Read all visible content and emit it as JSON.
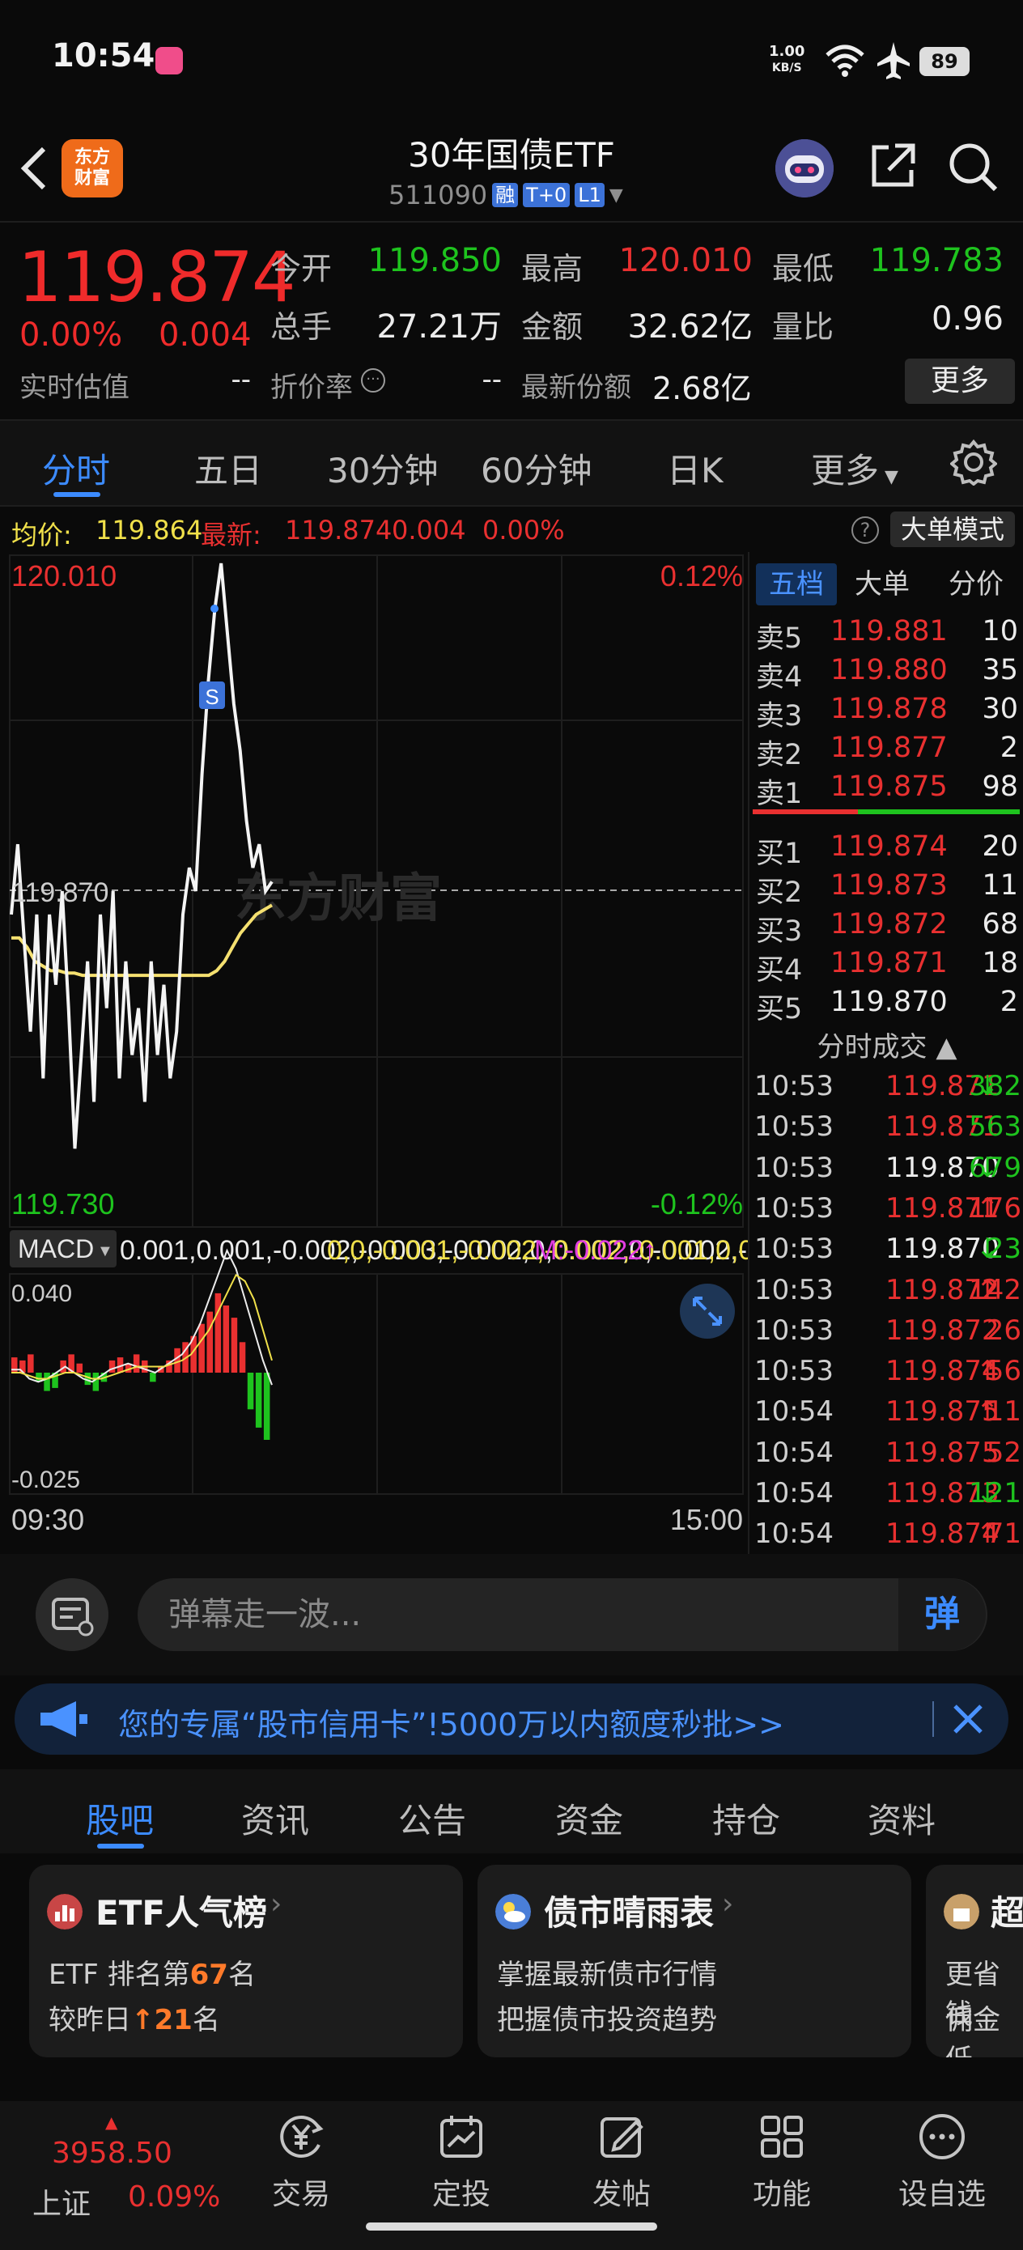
{
  "status_bar": {
    "time": "10:54",
    "speed_value": "1.00",
    "speed_unit": "KB/S",
    "battery": "89"
  },
  "header": {
    "title": "30年国债ETF",
    "code": "511090",
    "tags": [
      "融",
      "T+0",
      "L1"
    ],
    "logo_line1": "东方",
    "logo_line2": "财富"
  },
  "quote": {
    "price": "119.874",
    "change_pct": "0.00%",
    "change": "0.004",
    "open_label": "今开",
    "open": "119.850",
    "high_label": "最高",
    "high": "120.010",
    "low_label": "最低",
    "low": "119.783",
    "volume_label": "总手",
    "volume": "27.21万",
    "amount_label": "金额",
    "amount": "32.62亿",
    "ratio_label": "量比",
    "ratio": "0.96",
    "est_label": "实时估值",
    "est": "--",
    "discount_label": "折价率",
    "discount": "--",
    "shares_label": "最新份额",
    "shares": "2.68亿",
    "more_label": "更多"
  },
  "tabs": [
    "分时",
    "五日",
    "30分钟",
    "60分钟",
    "日K",
    "更多"
  ],
  "avg_row": {
    "avg_label": "均价:",
    "avg": "119.864",
    "latest_label": "最新:",
    "latest": "119.874",
    "chg": "0.004",
    "pct": "0.00%",
    "big_mode": "大单模式"
  },
  "chart_labels": {
    "y_top": "120.010",
    "y_mid": "119.870",
    "y_bottom": "119.730",
    "pct_top": "0.12%",
    "pct_bottom": "-0.12%",
    "watermark": "东方财富",
    "sell_marker": "S",
    "t_start": "09:30",
    "t_end": "15:00"
  },
  "chart_data": {
    "type": "line",
    "title": "",
    "ylim": [
      119.73,
      120.01
    ],
    "x_range": [
      "09:30",
      "15:00"
    ],
    "series": [
      {
        "values": [
          119.86,
          119.89,
          119.85,
          119.81,
          119.86,
          119.79,
          119.86,
          119.83,
          119.87,
          119.82,
          119.76,
          119.8,
          119.84,
          119.78,
          119.86,
          119.82,
          119.87,
          119.79,
          119.84,
          119.8,
          119.82,
          119.78,
          119.84,
          119.8,
          119.83,
          119.79,
          119.81,
          119.86,
          119.88,
          119.87,
          119.92,
          119.96,
          119.99,
          120.01,
          119.98,
          119.95,
          119.93,
          119.9,
          119.88,
          119.89,
          119.87,
          119.874
        ]
      },
      {
        "values": [
          119.85,
          119.85,
          119.846,
          119.84,
          119.838,
          119.836,
          119.836,
          119.835,
          119.835,
          119.834,
          119.834,
          119.834,
          119.834,
          119.834,
          119.834,
          119.834,
          119.834,
          119.834,
          119.834,
          119.834,
          119.834,
          119.834,
          119.834,
          119.834,
          119.834,
          119.834,
          119.836,
          119.84,
          119.846,
          119.852,
          119.856,
          119.86,
          119.862,
          119.864
        ]
      }
    ]
  },
  "macd": {
    "selector": "MACD",
    "dif": [
      0.001,
      0.001,
      -0.002,
      -0.003,
      -0.002,
      0.0,
      0.002,
      0.0,
      -0.002,
      -0.003,
      -0.001,
      0.001,
      0.002,
      0.003,
      0.002,
      0.001,
      0.0,
      0.002,
      0.004,
      0.006,
      0.01,
      0.016,
      0.024,
      0.032,
      0.04,
      0.034,
      0.024,
      0.014,
      0.004,
      -0.004
    ],
    "dea": [
      0.0,
      0.0,
      -0.001,
      -0.002,
      -0.002,
      -0.001,
      0.0,
      0.0,
      -0.001,
      -0.002,
      -0.002,
      -0.001,
      0.0,
      0.001,
      0.002,
      0.002,
      0.002,
      0.002,
      0.003,
      0.004,
      0.006,
      0.01,
      0.014,
      0.02,
      0.026,
      0.032,
      0.03,
      0.024,
      0.014,
      0.004
    ],
    "m": "M:-0.022↑",
    "top": "0.040",
    "bottom": "-0.025",
    "bars": [
      0.005,
      0.004,
      0.006,
      -0.003,
      -0.006,
      -0.005,
      0.004,
      0.006,
      0.003,
      -0.004,
      -0.006,
      -0.003,
      0.004,
      0.005,
      0.003,
      0.006,
      0.004,
      -0.003,
      0.002,
      0.004,
      0.008,
      0.01,
      0.012,
      0.016,
      0.02,
      0.026,
      0.022,
      0.018,
      0.01,
      -0.012,
      -0.018,
      -0.022
    ]
  },
  "book": {
    "tabs": [
      "五档",
      "大单",
      "分价"
    ],
    "asks": [
      {
        "label": "卖5",
        "price": "119.881",
        "vol": "10"
      },
      {
        "label": "卖4",
        "price": "119.880",
        "vol": "35"
      },
      {
        "label": "卖3",
        "price": "119.878",
        "vol": "30"
      },
      {
        "label": "卖2",
        "price": "119.877",
        "vol": "2"
      },
      {
        "label": "卖1",
        "price": "119.875",
        "vol": "98"
      }
    ],
    "bids": [
      {
        "label": "买1",
        "price": "119.874",
        "vol": "20"
      },
      {
        "label": "买2",
        "price": "119.873",
        "vol": "11"
      },
      {
        "label": "买3",
        "price": "119.872",
        "vol": "68"
      },
      {
        "label": "买4",
        "price": "119.871",
        "vol": "18"
      },
      {
        "label": "买5",
        "price": "119.870",
        "vol": "2"
      }
    ],
    "trade_header": "分时成交",
    "trades": [
      {
        "time": "10:53",
        "price": "119.871",
        "dir": "↓",
        "vol": "382",
        "pc": "red",
        "vc": "green"
      },
      {
        "time": "10:53",
        "price": "119.871",
        "dir": "",
        "vol": "563",
        "pc": "red",
        "vc": "green"
      },
      {
        "time": "10:53",
        "price": "119.870",
        "dir": "↓",
        "vol": "679",
        "pc": "white",
        "vc": "green"
      },
      {
        "time": "10:53",
        "price": "119.871",
        "dir": "↑",
        "vol": "176",
        "pc": "red",
        "vc": "red"
      },
      {
        "time": "10:53",
        "price": "119.870",
        "dir": "↓",
        "vol": "23",
        "pc": "white",
        "vc": "green"
      },
      {
        "time": "10:53",
        "price": "119.872",
        "dir": "↑",
        "vol": "142",
        "pc": "red",
        "vc": "red"
      },
      {
        "time": "10:53",
        "price": "119.872",
        "dir": "",
        "vol": "26",
        "pc": "red",
        "vc": "red"
      },
      {
        "time": "10:53",
        "price": "119.874",
        "dir": "↑",
        "vol": "56",
        "pc": "red",
        "vc": "red"
      },
      {
        "time": "10:54",
        "price": "119.875",
        "dir": "↑",
        "vol": "11",
        "pc": "red",
        "vc": "red"
      },
      {
        "time": "10:54",
        "price": "119.875",
        "dir": "",
        "vol": "52",
        "pc": "red",
        "vc": "red"
      },
      {
        "time": "10:54",
        "price": "119.873",
        "dir": "↓",
        "vol": "121",
        "pc": "red",
        "vc": "green"
      },
      {
        "time": "10:54",
        "price": "119.874",
        "dir": "↑",
        "vol": "71",
        "pc": "red",
        "vc": "red"
      }
    ]
  },
  "danmu": {
    "placeholder": "弹幕走一波...",
    "button": "弹"
  },
  "ad": {
    "text": "您的专属“股市信用卡”!5000万以内额度秒批>>"
  },
  "community_tabs": [
    "股吧",
    "资讯",
    "公告",
    "资金",
    "持仓",
    "资料"
  ],
  "cards": [
    {
      "title": "ETF人气榜",
      "line1_pre": "ETF 排名第",
      "line1_num": "67",
      "line1_post": "名",
      "line2_pre": "较昨日",
      "line2_num": "21",
      "line2_post": "名"
    },
    {
      "title": "债市晴雨表",
      "line1": "掌握最新债市行情",
      "line2": "把握债市投资趋势"
    },
    {
      "title": "超",
      "line1": "更省钱",
      "line2": "佣金低"
    }
  ],
  "bottom_nav": {
    "index_value": "3958.50",
    "index_name": "上证",
    "index_pct": "0.09%",
    "items": [
      "交易",
      "定投",
      "发帖",
      "功能",
      "设自选"
    ]
  },
  "colors": {
    "up": "#e93030",
    "down": "#1ec31e",
    "accent": "#3c8bff",
    "avg_line": "#f5e070"
  }
}
